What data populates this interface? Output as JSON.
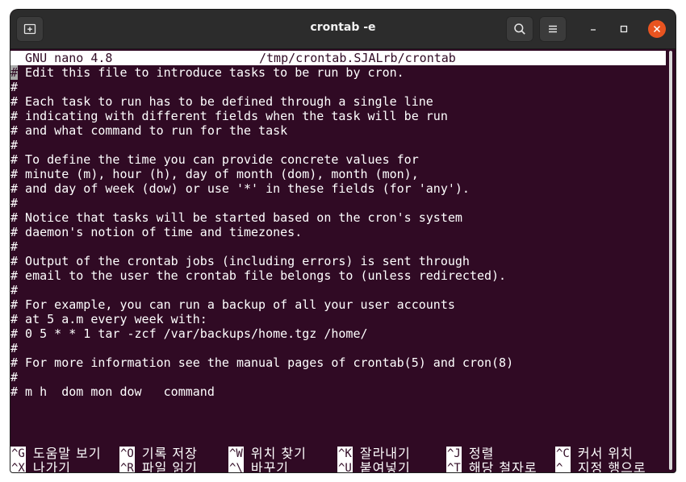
{
  "window": {
    "title": "crontab -e"
  },
  "nano": {
    "header_left": "  GNU nano 4.8",
    "header_file": "/tmp/crontab.SJALrb/crontab",
    "lines": [
      "# Edit this file to introduce tasks to be run by cron.",
      "#",
      "# Each task to run has to be defined through a single line",
      "# indicating with different fields when the task will be run",
      "# and what command to run for the task",
      "#",
      "# To define the time you can provide concrete values for",
      "# minute (m), hour (h), day of month (dom), month (mon),",
      "# and day of week (dow) or use '*' in these fields (for 'any').",
      "#",
      "# Notice that tasks will be started based on the cron's system",
      "# daemon's notion of time and timezones.",
      "#",
      "# Output of the crontab jobs (including errors) is sent through",
      "# email to the user the crontab file belongs to (unless redirected).",
      "#",
      "# For example, you can run a backup of all your user accounts",
      "# at 5 a.m every week with:",
      "# 0 5 * * 1 tar -zcf /var/backups/home.tgz /home/",
      "#",
      "# For more information see the manual pages of crontab(5) and cron(8)",
      "#",
      "# m h  dom mon dow   command"
    ],
    "shortcuts_row1": [
      {
        "key": "^G",
        "label": "도움말 보기"
      },
      {
        "key": "^O",
        "label": "기록 저장"
      },
      {
        "key": "^W",
        "label": "위치 찾기"
      },
      {
        "key": "^K",
        "label": "잘라내기"
      },
      {
        "key": "^J",
        "label": "정렬"
      },
      {
        "key": "^C",
        "label": "커서 위치"
      }
    ],
    "shortcuts_row2": [
      {
        "key": "^X",
        "label": "나가기"
      },
      {
        "key": "^R",
        "label": "파일 읽기"
      },
      {
        "key": "^\\",
        "label": "바꾸기"
      },
      {
        "key": "^U",
        "label": "붙여넣기"
      },
      {
        "key": "^T",
        "label": "해당 철자로"
      },
      {
        "key": "^_",
        "label": "지정 행으로"
      }
    ]
  },
  "colors": {
    "terminal_bg": "#300a24",
    "titlebar_bg": "#2c2c2c",
    "close_button": "#e95420"
  },
  "icons": {
    "new_tab": "new-tab-icon",
    "search": "search-icon",
    "menu": "hamburger-menu-icon",
    "minimize": "minimize-icon",
    "maximize": "maximize-icon",
    "close": "close-icon"
  }
}
